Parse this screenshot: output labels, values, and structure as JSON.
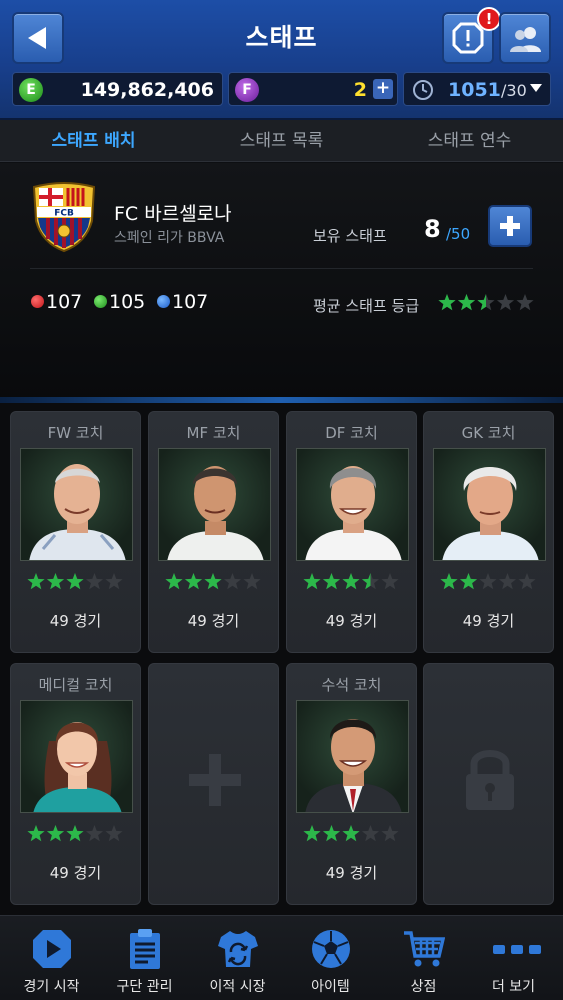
{
  "header": {
    "title": "스태프",
    "alert_badge": "!"
  },
  "resources": {
    "e_icon_label": "E",
    "e_value": "149,862,406",
    "f_icon_label": "F",
    "f_value": "2",
    "f_add": "+",
    "time_value": "1051",
    "time_max": "/30"
  },
  "tabs": [
    {
      "label": "스태프 배치",
      "active": true
    },
    {
      "label": "스태프 목록",
      "active": false
    },
    {
      "label": "스태프 연수",
      "active": false
    }
  ],
  "club": {
    "name": "FC 바르셀로나",
    "league": "스페인 리가 BBVA",
    "owned_label": "보유 스태프",
    "owned_count": "8",
    "owned_max": "/50",
    "stat_red": "107",
    "stat_green": "105",
    "stat_blue": "107",
    "avg_label": "평균 스태프 등급",
    "avg_rating": 2.5,
    "crest_text": "FCB"
  },
  "staff": [
    {
      "role": "FW 코치",
      "rating": 3,
      "games": "49 경기"
    },
    {
      "role": "MF 코치",
      "rating": 3,
      "games": "49 경기"
    },
    {
      "role": "DF 코치",
      "rating": 3.5,
      "games": "49 경기"
    },
    {
      "role": "GK 코치",
      "rating": 2,
      "games": "49 경기"
    },
    {
      "role": "메디컬 코치",
      "rating": 3,
      "games": "49 경기"
    },
    {
      "role": "수석 코치",
      "rating": 3,
      "games": "49 경기"
    }
  ],
  "bottom_nav": [
    {
      "label": "경기 시작",
      "icon": "play-icon"
    },
    {
      "label": "구단 관리",
      "icon": "clipboard-icon"
    },
    {
      "label": "이적 시장",
      "icon": "jersey-icon"
    },
    {
      "label": "아이템",
      "icon": "soccer-ball-icon"
    },
    {
      "label": "상점",
      "icon": "cart-icon"
    },
    {
      "label": "더 보기",
      "icon": "more-icon"
    }
  ],
  "colors": {
    "header_blue": "#1d4ea7",
    "accent_blue": "#3da7ff",
    "star_green": "#2cb84a",
    "star_empty": "#3a3d42",
    "gold": "#ffe02e"
  }
}
